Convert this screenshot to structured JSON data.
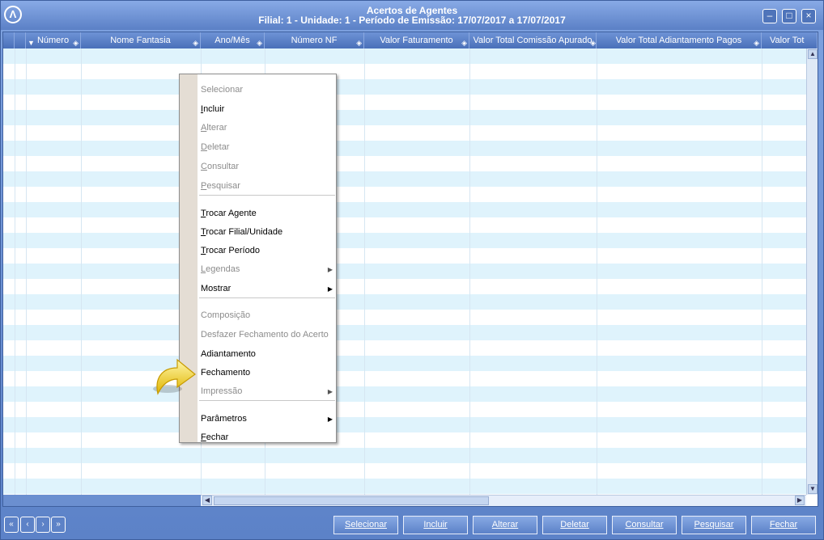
{
  "window": {
    "title_line1": "Acertos de Agentes",
    "title_line2": "Filial: 1 - Unidade: 1 - Período de Emissão: 17/07/2017 a 17/07/2017",
    "logo_icon": "app-logo-icon",
    "controls": [
      "minimize-icon",
      "maximize-icon",
      "close-icon"
    ]
  },
  "grid": {
    "columns": [
      "Número",
      "Nome Fantasia",
      "Ano/Mês",
      "Número NF",
      "Valor Faturamento",
      "Valor Total Comissão Apurado",
      "Valor Total Adiantamento Pagos",
      "Valor Tot"
    ],
    "row_colors": {
      "odd": "#dff3fc",
      "even": "#ffffff"
    }
  },
  "context_menu": {
    "items": [
      {
        "label": "Selecionar",
        "underline": "",
        "rest": "Selecionar",
        "enabled": false
      },
      {
        "label": "Incluir",
        "underline": "I",
        "rest": "ncluir",
        "enabled": true
      },
      {
        "label": "Alterar",
        "underline": "A",
        "rest": "lterar",
        "enabled": false
      },
      {
        "label": "Deletar",
        "underline": "D",
        "rest": "eletar",
        "enabled": false
      },
      {
        "label": "Consultar",
        "underline": "C",
        "rest": "onsultar",
        "enabled": false
      },
      {
        "label": "Pesquisar",
        "underline": "P",
        "rest": "esquisar",
        "enabled": false
      },
      {
        "label": "Trocar Agente",
        "underline": "T",
        "rest": "rocar Agente",
        "enabled": true
      },
      {
        "label": "Trocar Filial/Unidade",
        "underline": "T",
        "rest": "rocar Filial/Unidade",
        "enabled": true
      },
      {
        "label": "Trocar Período",
        "underline": "T",
        "rest": "rocar Período",
        "enabled": true
      },
      {
        "label": "Legendas",
        "underline": "L",
        "rest": "egendas",
        "enabled": false,
        "submenu": true
      },
      {
        "label": "Mostrar",
        "underline": "",
        "rest": "Mostrar",
        "enabled": true,
        "submenu": true
      },
      {
        "label": "Composição",
        "underline": "",
        "rest": "Composição",
        "enabled": false
      },
      {
        "label": "Desfazer Fechamento do Acerto",
        "underline": "",
        "rest": "Desfazer Fechamento do Acerto",
        "enabled": false
      },
      {
        "label": "Adiantamento",
        "underline": "",
        "rest": "Adiantamento",
        "enabled": true
      },
      {
        "label": "Fechamento",
        "underline": "",
        "rest": "Fechamento",
        "enabled": true
      },
      {
        "label": "Impressão",
        "underline": "",
        "rest": "Impressão",
        "enabled": false,
        "submenu": true
      },
      {
        "label": "Parâmetros",
        "underline": "",
        "rest": "Parâmetros",
        "enabled": true,
        "submenu": true
      },
      {
        "label": "Fechar",
        "underline": "F",
        "rest": "echar",
        "enabled": true
      }
    ]
  },
  "navigation": {
    "icons": [
      "first-record-icon",
      "previous-record-icon",
      "next-record-icon",
      "last-record-icon"
    ]
  },
  "actions": {
    "selecionar": "Selecionar",
    "incluir": "Incluir",
    "alterar": "Alterar",
    "deletar": "Deletar",
    "consultar": "Consultar",
    "pesquisar": "Pesquisar",
    "fechar": "Fechar"
  }
}
